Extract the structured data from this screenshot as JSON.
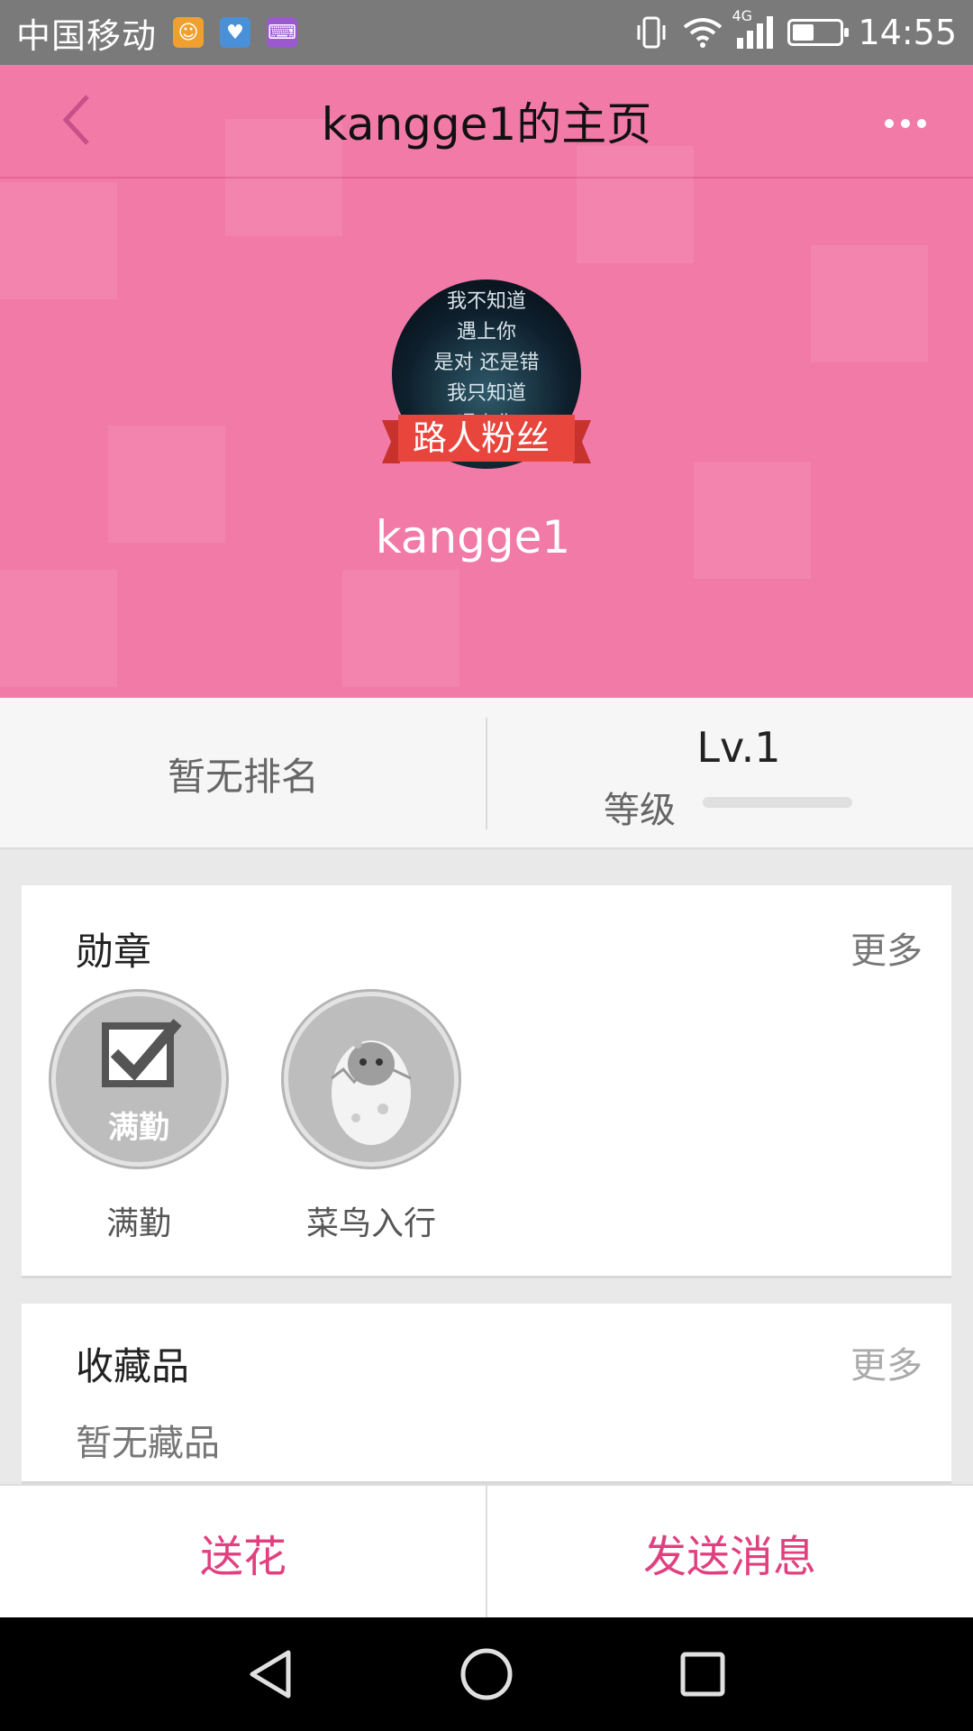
{
  "status_bar": {
    "carrier": "中国移动",
    "network": "4G",
    "time": "14:55",
    "battery_level": 0.45,
    "notification_icons": [
      "uc-browser-icon",
      "health-app-icon",
      "keyboard-app-icon"
    ]
  },
  "header": {
    "title": "kangge1的主页",
    "back_icon": "back-arrow-icon",
    "more_icon": "more-dots-icon"
  },
  "profile": {
    "avatar_text": [
      "我不知道",
      "遇上你",
      "是对 还是错",
      "我只知道",
      "遇上你"
    ],
    "fan_badge": "路人粉丝",
    "username": "kangge1"
  },
  "stats": {
    "rank_text": "暂无排名",
    "level": "Lv.1",
    "level_label": "等级",
    "level_progress": 0.0
  },
  "medals": {
    "title": "勋章",
    "more": "更多",
    "items": [
      {
        "label": "满勤",
        "icon": "full-attendance-badge-icon",
        "badge_text": "满勤"
      },
      {
        "label": "菜鸟入行",
        "icon": "newbie-chick-egg-icon"
      }
    ]
  },
  "collections": {
    "title": "收藏品",
    "more": "更多",
    "empty_text": "暂无藏品"
  },
  "actions": {
    "send_flower": "送花",
    "send_message": "发送消息"
  },
  "colors": {
    "header_pink": "#f17aa7",
    "accent": "#e0407f",
    "badge_red": "#e8453c"
  }
}
